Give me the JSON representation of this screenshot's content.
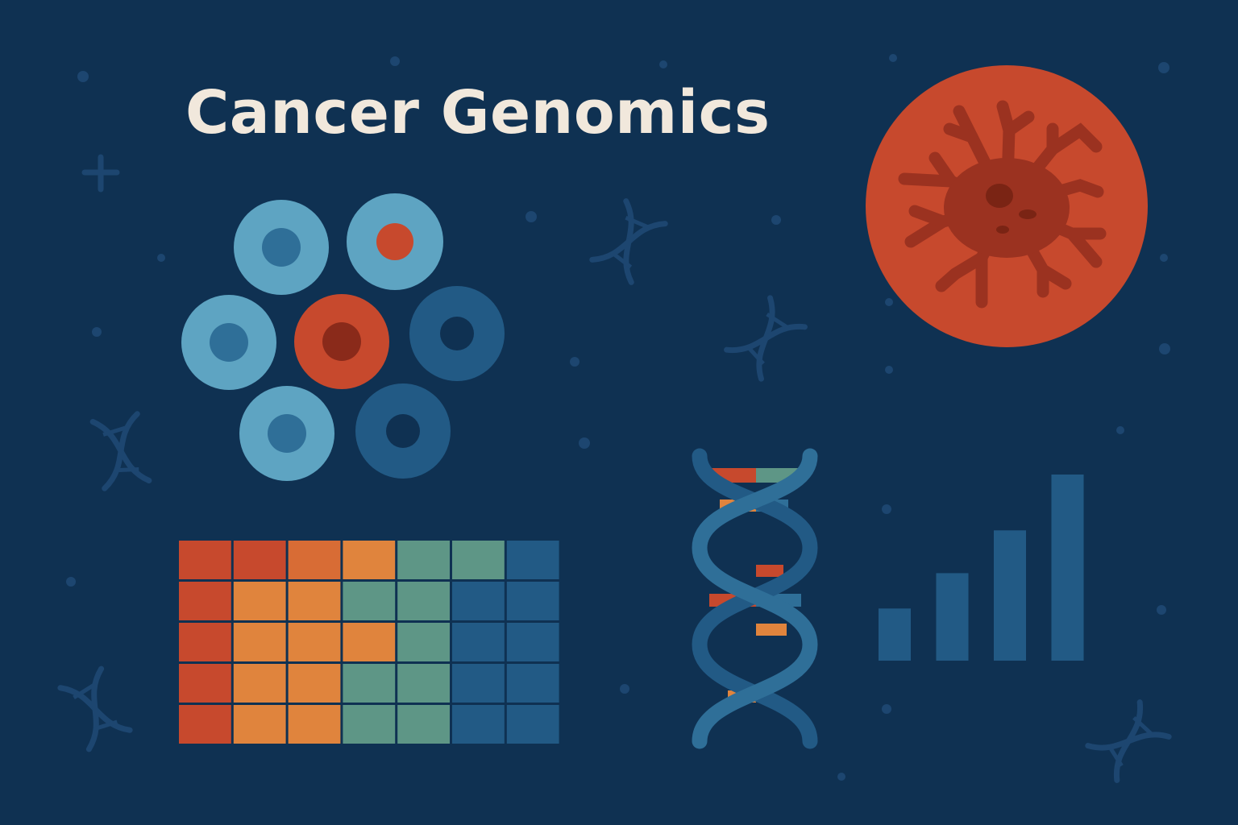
{
  "title": "Cancer Genomics",
  "colors": {
    "background": "#0f3152",
    "title_text": "#f1e8dc",
    "accent_red": "#c7492d",
    "dark_red": "#8a2a1a",
    "light_blue": "#5ea4c2",
    "mid_blue": "#2f6f98",
    "deep_blue": "#225a85",
    "orange": "#e0843d",
    "teal": "#5e9686"
  },
  "icons": [
    "cell-cluster-icon",
    "cancer-cell-icon",
    "heatmap-icon",
    "dna-helix-icon",
    "bar-chart-icon",
    "background-dna-icon",
    "plus-icon"
  ],
  "heatmap": {
    "rows": [
      [
        "#c7492d",
        "#c7492d",
        "#d86c35",
        "#e0843d",
        "#5e9686",
        "#5e9686",
        "#225a85"
      ],
      [
        "#c7492d",
        "#e0843d",
        "#e0843d",
        "#5e9686",
        "#5e9686",
        "#225a85",
        "#225a85"
      ],
      [
        "#c7492d",
        "#e0843d",
        "#e0843d",
        "#e0843d",
        "#5e9686",
        "#225a85",
        "#225a85"
      ],
      [
        "#c7492d",
        "#e0843d",
        "#e0843d",
        "#5e9686",
        "#5e9686",
        "#225a85",
        "#225a85"
      ],
      [
        "#c7492d",
        "#e0843d",
        "#e0843d",
        "#5e9686",
        "#5e9686",
        "#225a85",
        "#225a85"
      ]
    ]
  },
  "bar_chart": {
    "values": [
      0.28,
      0.47,
      0.7,
      1.0
    ]
  }
}
